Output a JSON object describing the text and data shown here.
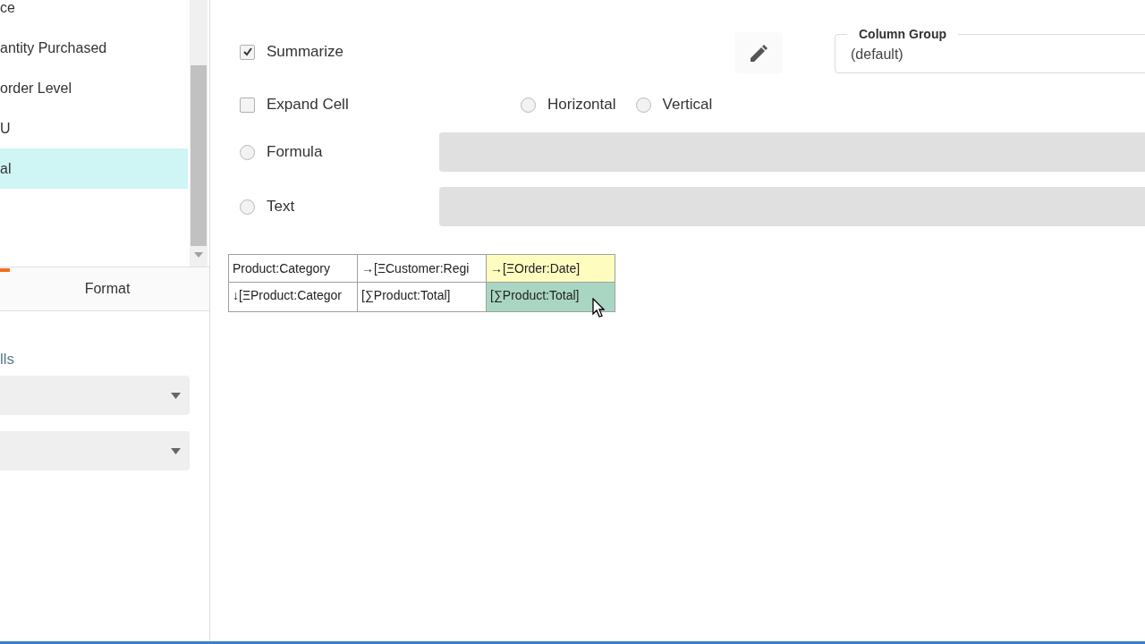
{
  "field_list": [
    {
      "label": "ce",
      "selected": false
    },
    {
      "label": "antity Purchased",
      "selected": false
    },
    {
      "label": "order Level",
      "selected": false
    },
    {
      "label": "U",
      "selected": false
    },
    {
      "label": "al",
      "selected": true
    }
  ],
  "tabs": [
    {
      "label": "Format",
      "selected": false
    }
  ],
  "format_section": {
    "heading": "lls",
    "dropdowns": [
      {
        "kind": "dropdown"
      },
      {
        "kind": "dropdown"
      }
    ]
  },
  "options": [
    {
      "kind": "checkbox",
      "label": "Summarize",
      "checked": true,
      "group_box": {
        "legend": "Column Group",
        "value": "(default)"
      }
    },
    {
      "kind": "checkbox",
      "label": "Expand Cell",
      "checked": false,
      "radios": [
        {
          "label": "Horizontal",
          "selected": false
        },
        {
          "label": "Vertical",
          "selected": false
        }
      ]
    },
    {
      "kind": "radio",
      "label": "Formula",
      "selected": false
    },
    {
      "kind": "radio",
      "label": "Text",
      "selected": false
    }
  ],
  "grid": {
    "rows": [
      [
        {
          "text": "Product:Category",
          "color": "#ffffff"
        },
        {
          "text": "→[ΞCustomer:Regi",
          "color": "#ffffff"
        },
        {
          "text": "→[ΞOrder:Date]",
          "color": "#fffcc0"
        }
      ],
      [
        {
          "text": "↓[ΞProduct:Categor",
          "color": "#ffffff"
        },
        {
          "text": "[∑Product:Total]",
          "color": "#ffffff"
        },
        {
          "text": "[∑Product:Total]",
          "color": "#a9d6c3"
        }
      ]
    ]
  }
}
